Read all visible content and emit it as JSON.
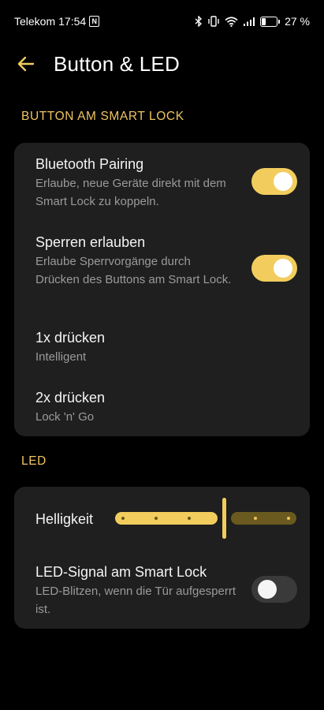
{
  "status_bar": {
    "carrier": "Telekom",
    "time": "17:54",
    "nfc": "N",
    "battery_percent": "27 %",
    "battery_level": 0.27
  },
  "header": {
    "title": "Button & LED",
    "back_icon": "arrow-left-icon"
  },
  "colors": {
    "accent": "#f2cd5e",
    "accent_dim": "#6b5a1f",
    "card_bg": "#1f1f1f",
    "section_label": "#f0c462",
    "toggle_off": "#3a3a3a"
  },
  "sections": {
    "button": {
      "label": "BUTTON AM SMART LOCK",
      "items": [
        {
          "title": "Bluetooth Pairing",
          "subtitle": "Erlaube, neue Geräte direkt mit dem Smart Lock zu koppeln.",
          "toggle": true
        },
        {
          "title": "Sperren erlauben",
          "subtitle": "Erlaube Sperrvorgänge durch Drücken des Buttons am Smart Lock.",
          "toggle": true
        },
        {
          "title": "1x drücken",
          "subtitle": "Intelligent"
        },
        {
          "title": "2x drücken",
          "subtitle": "Lock 'n' Go"
        }
      ]
    },
    "led": {
      "label": "LED",
      "brightness": {
        "title": "Helligkeit",
        "value_fraction": 0.6,
        "steps": 6
      },
      "signal": {
        "title": "LED-Signal am Smart Lock",
        "subtitle": "LED-Blitzen, wenn die Tür aufgesperrt ist.",
        "toggle": false
      }
    }
  }
}
